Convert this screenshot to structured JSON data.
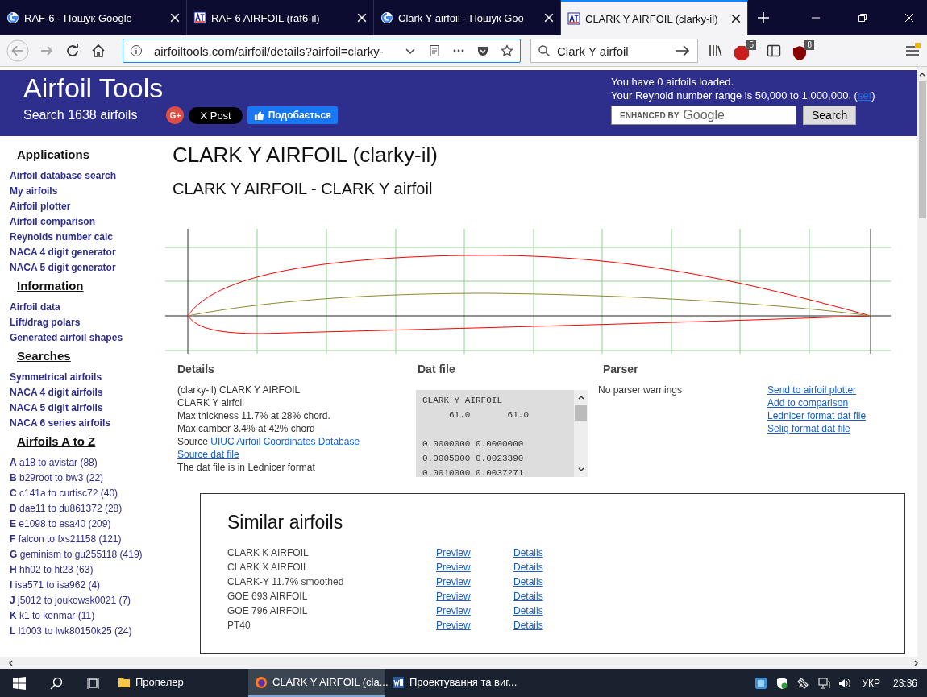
{
  "browser": {
    "tabs": [
      {
        "title": "RAF-6 - Пошук Google",
        "kind": "google",
        "selected": false
      },
      {
        "title": "RAF 6 AIRFOIL (raf6-il)",
        "kind": "site",
        "selected": false
      },
      {
        "title": "Clark Y airfoil - Пошук Goo",
        "kind": "google",
        "selected": false
      },
      {
        "title": "CLARK Y AIRFOIL (clarky-il)",
        "kind": "site",
        "selected": true
      }
    ],
    "url": "airfoiltools.com/airfoil/details?airfoil=clarky-",
    "search_value": "Clark Y airfoil",
    "adblock_count": "5",
    "ublock_count": "8"
  },
  "header": {
    "title": "Airfoil Tools",
    "subtitle": "Search 1638 airfoils",
    "gplus": "G+",
    "x_post": "X Post",
    "like": "Подобається",
    "loaded": "You have 0 airfoils loaded.",
    "range": "Your Reynold number range is 50,000 to 1,000,000. (",
    "range_link": "set",
    "range_end": ")",
    "search_hint": "ENHANCED BY",
    "search_brand": "Google",
    "search_button": "Search"
  },
  "sidebar": [
    {
      "heading": "Applications",
      "items": [
        "Airfoil database search",
        "My airfoils",
        "Airfoil plotter",
        "Airfoil comparison",
        "Reynolds number calc",
        "NACA 4 digit generator",
        "NACA 5 digit generator"
      ]
    },
    {
      "heading": "Information",
      "items": [
        "Airfoil data",
        "Lift/drag polars",
        "Generated airfoil shapes"
      ]
    },
    {
      "heading": "Searches",
      "items": [
        "Symmetrical airfoils",
        "NACA 4 digit airfoils",
        "NACA 5 digit airfoils",
        "NACA 6 series airfoils"
      ]
    },
    {
      "heading": "Airfoils A to Z",
      "az": [
        {
          "letter": "A",
          "text": "a18 to avistar (88)"
        },
        {
          "letter": "B",
          "text": "b29root to bw3 (22)"
        },
        {
          "letter": "C",
          "text": "c141a to curtisc72 (40)"
        },
        {
          "letter": "D",
          "text": "dae11 to du861372 (28)"
        },
        {
          "letter": "E",
          "text": "e1098 to esa40 (209)"
        },
        {
          "letter": "F",
          "text": "falcon to fxs21158 (121)"
        },
        {
          "letter": "G",
          "text": "geminism to gu255118 (419)"
        },
        {
          "letter": "H",
          "text": "hh02 to ht23 (63)"
        },
        {
          "letter": "I",
          "text": "isa571 to isa962 (4)"
        },
        {
          "letter": "J",
          "text": "j5012 to joukowsk0021 (7)"
        },
        {
          "letter": "K",
          "text": "k1 to kenmar (11)"
        },
        {
          "letter": "L",
          "text": "l1003 to lwk80150k25 (24)"
        }
      ]
    }
  ],
  "main": {
    "title": "CLARK Y AIRFOIL (clarky-il)",
    "subtitle": "CLARK Y AIRFOIL - CLARK Y airfoil",
    "details": {
      "heading": "Details",
      "lines": [
        "(clarky-il) CLARK Y AIRFOIL",
        "CLARK Y airfoil",
        "Max thickness 11.7% at 28% chord.",
        "Max camber 3.4% at 42% chord"
      ],
      "source_label": "Source",
      "source_link": "UIUC Airfoil Coordinates Database",
      "dat_link": "Source dat file",
      "note": "The dat file is in Lednicer format"
    },
    "dat_file": {
      "heading": "Dat file",
      "lines": [
        "CLARK Y AIRFOIL",
        "     61.0       61.0",
        "0.0000000 0.0000000",
        "0.0005000 0.0023390",
        "0.0010000 0.0037271"
      ]
    },
    "parser": {
      "heading": "Parser",
      "message": "No parser warnings",
      "links": [
        "Send to airfoil plotter",
        "Add to comparison",
        "Lednicer format dat file",
        "Selig format dat file"
      ]
    },
    "similar": {
      "heading": "Similar airfoils",
      "rows": [
        {
          "name": "CLARK K AIRFOIL",
          "preview": "Preview",
          "details": "Details"
        },
        {
          "name": "CLARK X AIRFOIL",
          "preview": "Preview",
          "details": "Details"
        },
        {
          "name": "CLARK-Y 11.7% smoothed",
          "preview": "Preview",
          "details": "Details"
        },
        {
          "name": "GOE 693 AIRFOIL",
          "preview": "Preview",
          "details": "Details"
        },
        {
          "name": "GOE 796 AIRFOIL",
          "preview": "Preview",
          "details": "Details"
        },
        {
          "name": "PT40",
          "preview": "Preview",
          "details": "Details"
        }
      ]
    }
  },
  "taskbar": {
    "items": [
      {
        "label": "Пропелер",
        "kind": "folder",
        "selected": false
      },
      {
        "label": "CLARK Y AIRFOIL (cla...",
        "kind": "browser",
        "selected": true
      },
      {
        "label": "Проектування та виг...",
        "kind": "word",
        "selected": false
      }
    ],
    "language": "УКР",
    "time": "23:36"
  }
}
